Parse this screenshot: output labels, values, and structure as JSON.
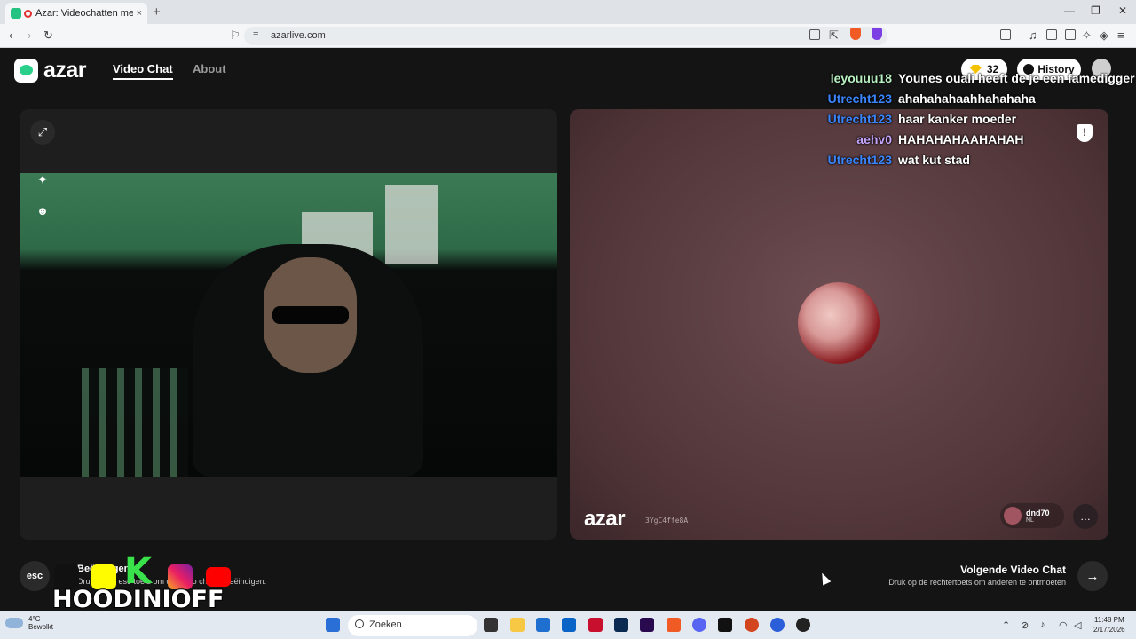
{
  "browser": {
    "tab_title": "Azar: Videochatten met nieu",
    "tab_close": "×",
    "new_tab": "+",
    "url": "azarlive.com",
    "window_minimize": "—",
    "window_maximize": "❐",
    "window_close": "✕"
  },
  "app": {
    "logo_text": "azar",
    "nav": {
      "video_chat": "Video Chat",
      "about": "About"
    },
    "gems_count": "32",
    "history_label": "History"
  },
  "left_panel": {
    "expand_icon": "⤢",
    "wand_icon": "✦",
    "emoji_icon": "☻"
  },
  "right_panel": {
    "report_icon": "!",
    "watermark": "azar",
    "watermark_id": "3YgC4ffe8A",
    "peer_name": "dnd70",
    "peer_country": "NL",
    "chat_icon": "…"
  },
  "chat": [
    {
      "user": "leyouuu18",
      "color": "#b9f2c2",
      "message": "Younes ouali heeft de je een famedigger"
    },
    {
      "user": "Utrecht123",
      "color": "#3b86ff",
      "message": "ahahahahaahhahahaha"
    },
    {
      "user": "Utrecht123",
      "color": "#3b86ff",
      "message": "haar kanker moeder"
    },
    {
      "user": "aehv0",
      "color": "#c7a6ff",
      "message": "HAHAHAHAAHAHAH"
    },
    {
      "user": "Utrecht123",
      "color": "#3b86ff",
      "message": "wat kut stad"
    }
  ],
  "footer": {
    "esc_label": "esc",
    "left_title": "Beëindigen",
    "left_sub": "Druk op de esc-toets om de video chat te beëindigen.",
    "right_title": "Volgende Video Chat",
    "right_sub": "Druk op de rechtertoets om anderen te ontmoeten",
    "next_icon": "→"
  },
  "overlay": {
    "brand": "HOODINIOFF",
    "k_letter": "K"
  },
  "taskbar": {
    "temp": "4°C",
    "weather": "Bewolkt",
    "search_placeholder": "Zoeken",
    "time": "11:48 PM",
    "date": "2/17/2026"
  }
}
